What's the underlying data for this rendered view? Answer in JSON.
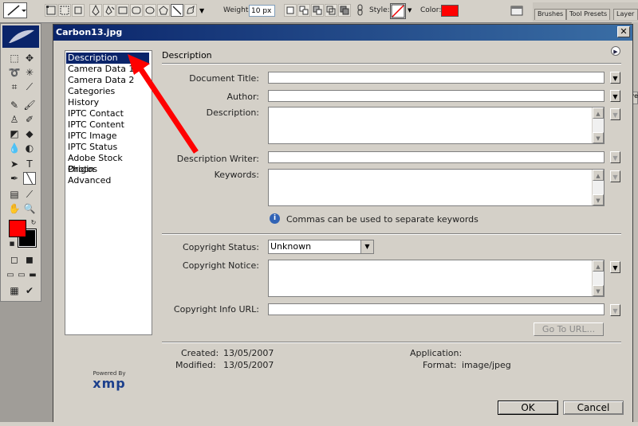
{
  "options_bar": {
    "weight_label": "Weight:",
    "weight_value": "10 px",
    "style_label": "Style:",
    "color_label": "Color:",
    "color_value": "#ff0000",
    "palette_tabs": [
      "Brushes",
      "Tool Presets",
      "Layer"
    ]
  },
  "toolbox": {
    "foreground_color": "#ff0000",
    "background_color": "#000000"
  },
  "dialog": {
    "title": "Carbon13.jpg",
    "close_glyph": "✕",
    "categories": [
      {
        "label": "Description",
        "selected": true
      },
      {
        "label": "Camera Data 1"
      },
      {
        "label": "Camera Data 2"
      },
      {
        "label": "Categories"
      },
      {
        "label": "History"
      },
      {
        "label": "IPTC Contact"
      },
      {
        "label": "IPTC Content"
      },
      {
        "label": "IPTC Image"
      },
      {
        "label": "IPTC Status"
      },
      {
        "label": "Adobe Stock Photos"
      },
      {
        "label": "Origin"
      },
      {
        "label": "Advanced"
      }
    ],
    "section_title": "Description",
    "fields": {
      "document_title": {
        "label": "Document Title:",
        "value": ""
      },
      "author": {
        "label": "Author:",
        "value": ""
      },
      "description": {
        "label": "Description:",
        "value": ""
      },
      "description_writer": {
        "label": "Description Writer:",
        "value": ""
      },
      "keywords": {
        "label": "Keywords:",
        "value": ""
      },
      "keywords_hint": "Commas can be used to separate keywords",
      "copyright_status": {
        "label": "Copyright Status:",
        "value": "Unknown"
      },
      "copyright_notice": {
        "label": "Copyright Notice:",
        "value": ""
      },
      "copyright_url": {
        "label": "Copyright Info URL:",
        "value": ""
      }
    },
    "goto_url_label": "Go To URL...",
    "meta": {
      "created_label": "Created:",
      "created_value": "13/05/2007",
      "modified_label": "Modified:",
      "modified_value": "13/05/2007",
      "application_label": "Application:",
      "application_value": "",
      "format_label": "Format:",
      "format_value": "image/jpeg"
    },
    "xmp_powered_by": "Powered By",
    "xmp_logo": "xmp",
    "ok_label": "OK",
    "cancel_label": "Cancel"
  },
  "annotation_arrow_color": "#ff0000"
}
